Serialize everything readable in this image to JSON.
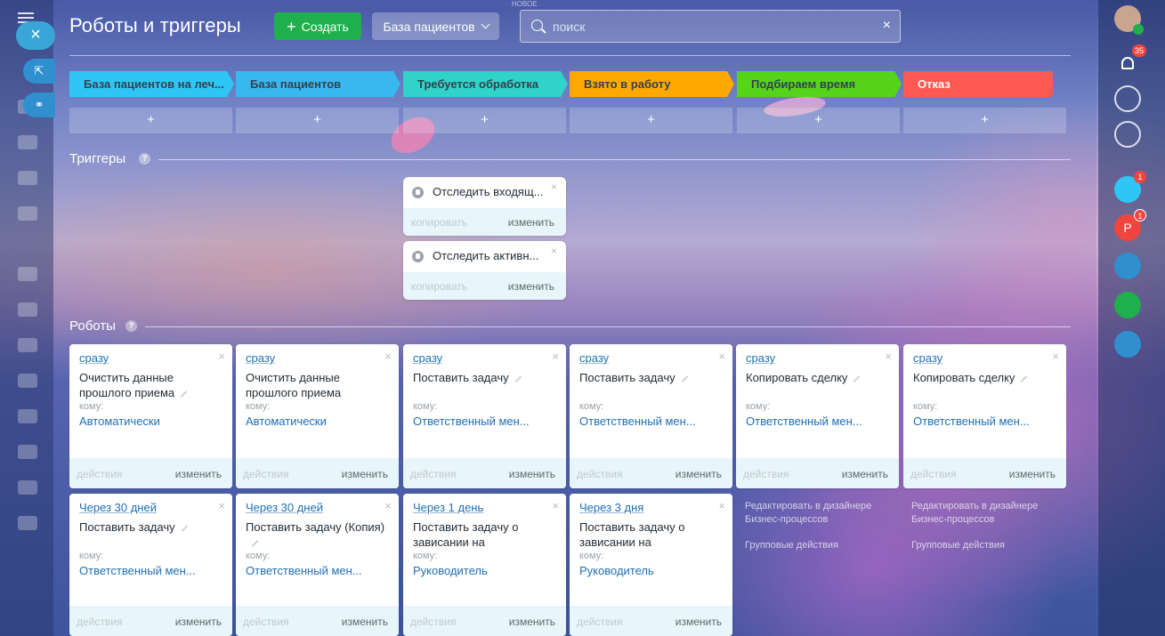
{
  "header": {
    "title": "Роботы и триггеры",
    "create_label": "Создать",
    "category_label": "База пациентов",
    "search_placeholder": "поиск",
    "top_hint": "НОВОЕ"
  },
  "left_menu": {
    "badge": "3"
  },
  "right_bar": {
    "notifications_badge": "35",
    "bot_badge": "1",
    "p_badge": "1",
    "p_letter": "P"
  },
  "stages": [
    {
      "label": "База пациентов на леч...",
      "color": "#2fc6f6"
    },
    {
      "label": "База пациентов",
      "color": "#39b8f0"
    },
    {
      "label": "Требуется обработка",
      "color": "#2fd3c8"
    },
    {
      "label": "Взято в работу",
      "color": "#ffa900"
    },
    {
      "label": "Подбираем время",
      "color": "#56d41c"
    },
    {
      "label": "Отказ",
      "color": "#ff5752"
    }
  ],
  "add_label": "+",
  "triggers_section": "Триггеры",
  "robots_section": "Роботы",
  "help": "?",
  "close": "×",
  "triggers": [
    {
      "title": "Отследить входящ...",
      "copy": "копировать",
      "edit": "изменить"
    },
    {
      "title": "Отследить активн...",
      "copy": "копировать",
      "edit": "изменить"
    }
  ],
  "robots": [
    [
      {
        "when": "сразу",
        "title": "Очистить данные прошлого приема",
        "to_label": "кому:",
        "to": "Автоматически",
        "actions": "действия",
        "edit": "изменить"
      },
      {
        "when": "Через 30 дней",
        "title": "Поставить задачу",
        "to_label": "кому:",
        "to": "Ответственный мен...",
        "actions": "действия",
        "edit": "изменить"
      }
    ],
    [
      {
        "when": "сразу",
        "title": "Очистить данные прошлого приема",
        "to_label": "кому:",
        "to": "Автоматически",
        "actions": "действия",
        "edit": "изменить"
      },
      {
        "when": "Через 30 дней",
        "title": "Поставить задачу (Копия)",
        "to_label": "кому:",
        "to": "Ответственный мен...",
        "actions": "действия",
        "edit": "изменить"
      }
    ],
    [
      {
        "when": "сразу",
        "title": "Поставить задачу",
        "to_label": "кому:",
        "to": "Ответственный мен...",
        "actions": "действия",
        "edit": "изменить"
      },
      {
        "when": "Через 1 день",
        "title": "Поставить задачу о зависании на",
        "to_label": "кому:",
        "to": "Руководитель",
        "actions": "действия",
        "edit": "изменить"
      }
    ],
    [
      {
        "when": "сразу",
        "title": "Поставить задачу",
        "to_label": "кому:",
        "to": "Ответственный мен...",
        "actions": "действия",
        "edit": "изменить"
      },
      {
        "when": "Через 3 дня",
        "title": "Поставить задачу о зависании на",
        "to_label": "кому:",
        "to": "Руководитель",
        "actions": "действия",
        "edit": "изменить"
      }
    ],
    [
      {
        "when": "сразу",
        "title": "Копировать сделку",
        "to_label": "кому:",
        "to": "Ответственный мен...",
        "actions": "действия",
        "edit": "изменить"
      }
    ],
    [
      {
        "when": "сразу",
        "title": "Копировать сделку",
        "to_label": "кому:",
        "to": "Ответственный мен...",
        "actions": "действия",
        "edit": "изменить"
      }
    ]
  ],
  "bp_links": {
    "edit_in_designer": "Редактировать в дизайнере Бизнес-процессов",
    "group_actions": "Групповые действия"
  }
}
